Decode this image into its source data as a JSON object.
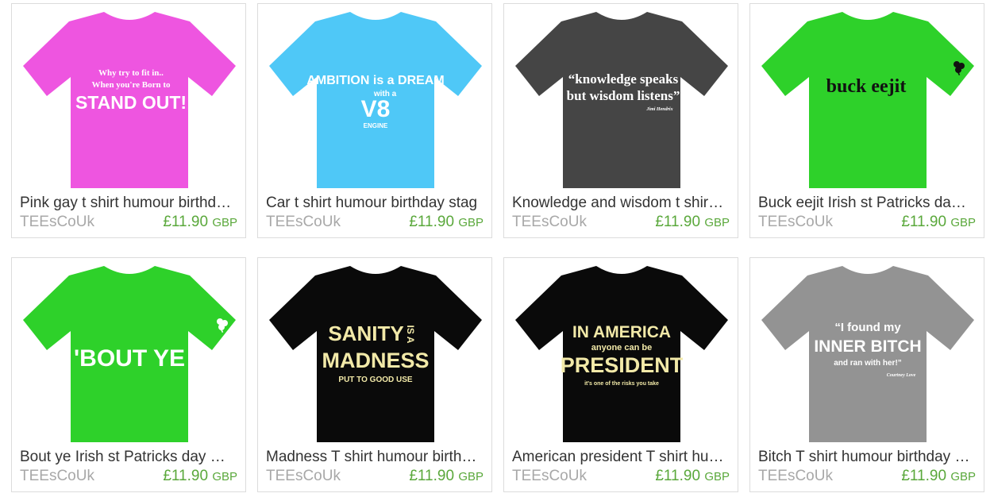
{
  "products": [
    {
      "title": "Pink gay t shirt humour birthd…",
      "seller": "TEEsCoUk",
      "price": "£11.90",
      "currency": "GBP",
      "shirt_color": "#ee55e0",
      "print_lines": [
        "Why try to fit in..",
        "When you're Born to",
        "STAND OUT!"
      ]
    },
    {
      "title": "Car t shirt humour birthday stag",
      "seller": "TEEsCoUk",
      "price": "£11.90",
      "currency": "GBP",
      "shirt_color": "#4fc8f7",
      "print_lines": [
        "AMBITION is a DREAM",
        "with a",
        "V8",
        "ENGINE"
      ]
    },
    {
      "title": "Knowledge and wisdom t shir…",
      "seller": "TEEsCoUk",
      "price": "£11.90",
      "currency": "GBP",
      "shirt_color": "#454545",
      "print_lines": [
        "“knowledge speaks",
        "but wisdom listens”",
        "Jimi Hendrix"
      ]
    },
    {
      "title": "Buck eejit Irish st Patricks da…",
      "seller": "TEEsCoUk",
      "price": "£11.90",
      "currency": "GBP",
      "shirt_color": "#2ed12a",
      "print_lines": [
        "buck eejit"
      ]
    },
    {
      "title": "Bout ye Irish st Patricks day …",
      "seller": "TEEsCoUk",
      "price": "£11.90",
      "currency": "GBP",
      "shirt_color": "#2ed12a",
      "print_lines": [
        "'BOUT YE"
      ]
    },
    {
      "title": "Madness T shirt humour birth…",
      "seller": "TEEsCoUk",
      "price": "£11.90",
      "currency": "GBP",
      "shirt_color": "#0a0a0a",
      "print_lines": [
        "SANITY",
        "IS A",
        "MADNESS",
        "PUT TO GOOD USE"
      ]
    },
    {
      "title": "American president T shirt hu…",
      "seller": "TEEsCoUk",
      "price": "£11.90",
      "currency": "GBP",
      "shirt_color": "#0a0a0a",
      "print_lines": [
        "IN AMERICA",
        "anyone can be",
        "PRESIDENT",
        "it's one of the risks you take"
      ]
    },
    {
      "title": "Bitch T shirt humour birthday …",
      "seller": "TEEsCoUk",
      "price": "£11.90",
      "currency": "GBP",
      "shirt_color": "#939393",
      "print_lines": [
        "“I found my",
        "INNER BITCH",
        "and ran with her!”",
        "Courtney Love"
      ]
    }
  ]
}
